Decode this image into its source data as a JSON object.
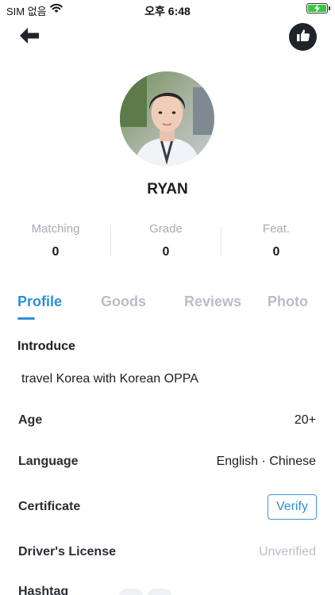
{
  "status_bar": {
    "carrier": "SIM 없음",
    "time": "오후 6:48"
  },
  "header": {
    "back_icon": "arrow-left-icon",
    "like_icon": "thumbs-up-icon"
  },
  "profile": {
    "name": "RYAN"
  },
  "stats": [
    {
      "label": "Matching",
      "value": "0"
    },
    {
      "label": "Grade",
      "value": "0"
    },
    {
      "label": "Feat.",
      "value": "0"
    }
  ],
  "tabs": [
    {
      "label": "Profile",
      "active": true
    },
    {
      "label": "Goods",
      "active": false
    },
    {
      "label": "Reviews",
      "active": false
    },
    {
      "label": "Photo",
      "active": false
    }
  ],
  "introduce": {
    "title": "Introduce",
    "text": "travel Korea with Korean OPPA"
  },
  "rows": {
    "age": {
      "label": "Age",
      "value": "20+"
    },
    "language": {
      "label": "Language",
      "value": "English · Chinese"
    },
    "certificate": {
      "label": "Certificate",
      "button": "Verify"
    },
    "drivers_license": {
      "label": "Driver's License",
      "value": "Unverified"
    },
    "hashtag": {
      "label": "Hashtag"
    }
  },
  "colors": {
    "accent": "#2e8fd8",
    "muted": "#b7bec6",
    "dark": "#1f232a"
  }
}
